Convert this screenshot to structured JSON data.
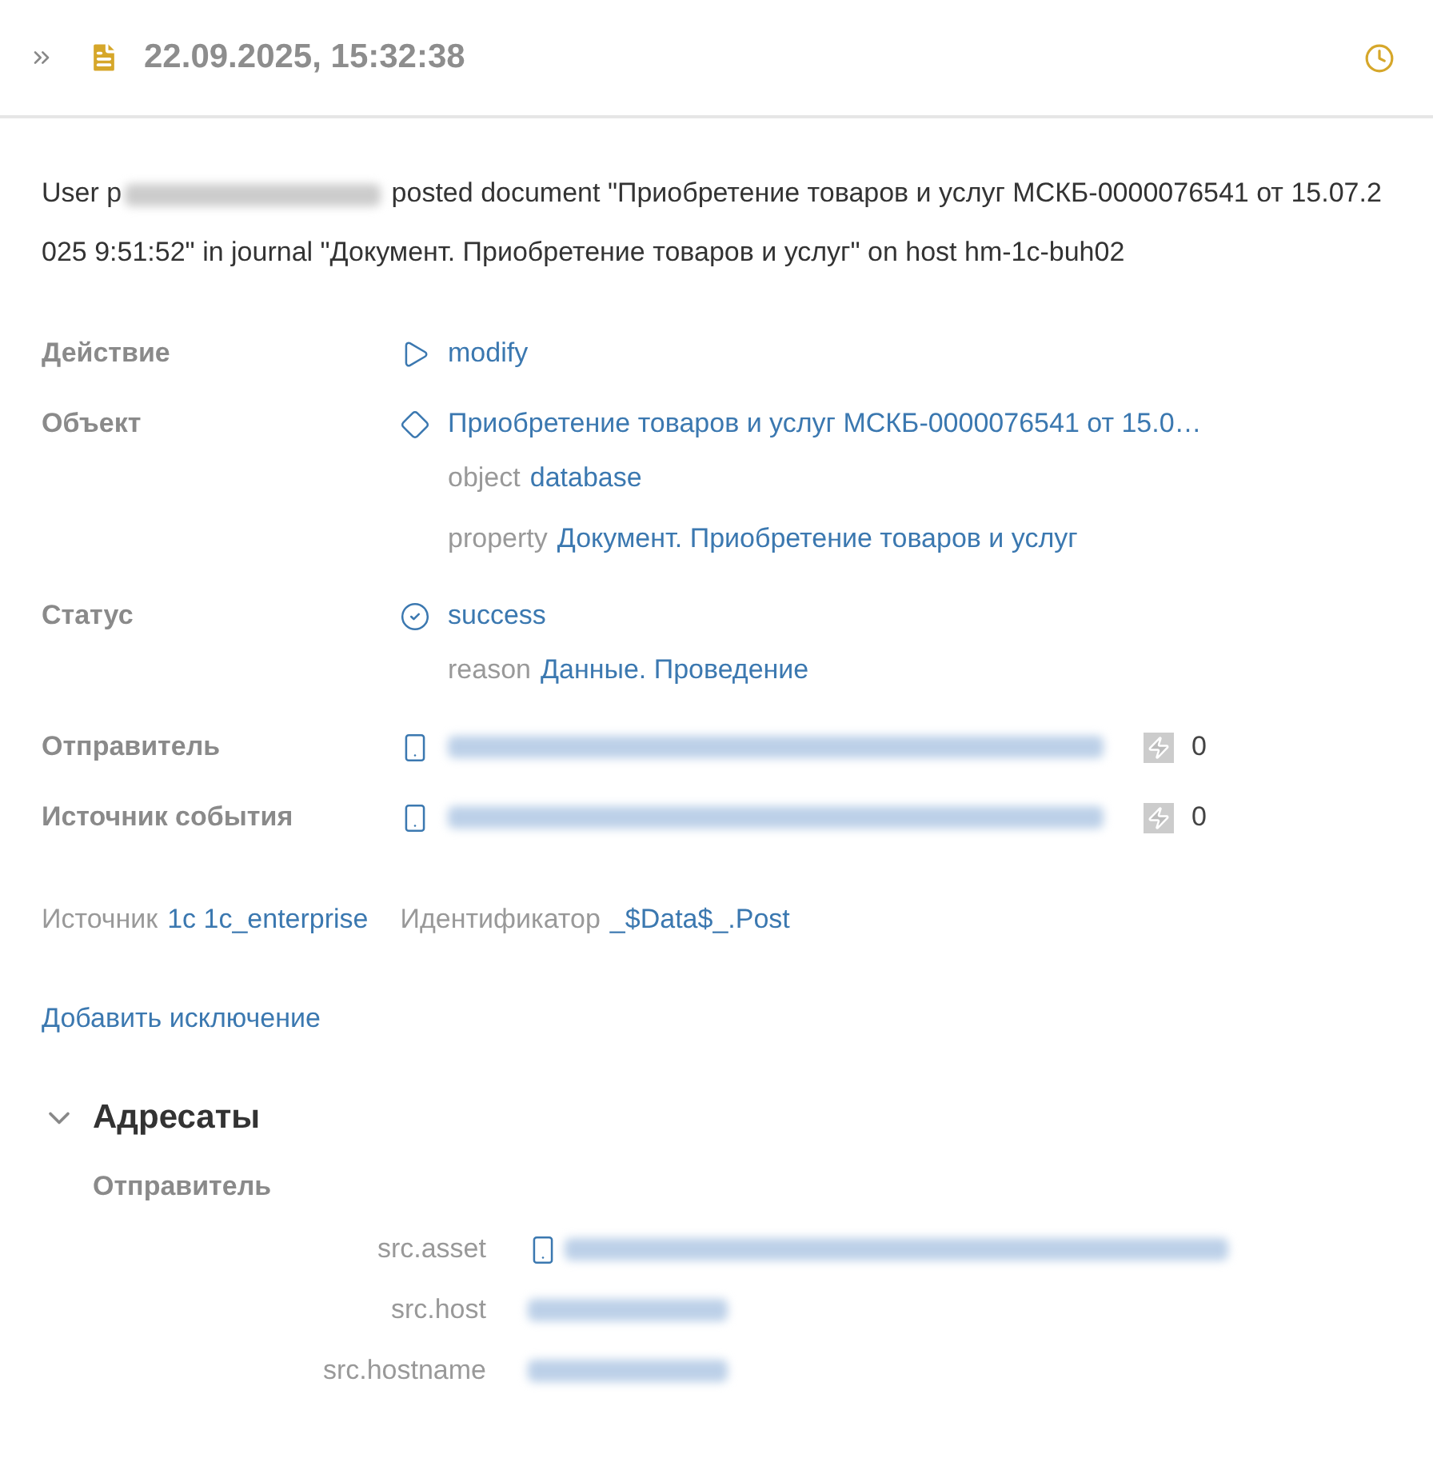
{
  "header": {
    "title": "22.09.2025, 15:32:38"
  },
  "summary": {
    "before": "User p",
    "after": " posted document \"Приобретение товаров и услуг МСКБ-0000076541 от 15.07.2025 9:51:52\" in journal \"Документ. Приобретение товаров и услуг\" on host hm-1c-buh02"
  },
  "fields": [
    {
      "label": "Действие",
      "kind": "action",
      "value": "modify"
    },
    {
      "label": "Объект",
      "kind": "object",
      "value": "Приобретение товаров и услуг МСКБ-0000076541 от 15.0…",
      "details": [
        {
          "key": "object",
          "value": "database"
        },
        {
          "key": "property",
          "value": "Документ. Приобретение товаров и услуг"
        }
      ]
    },
    {
      "label": "Статус",
      "kind": "status",
      "value": "success",
      "details": [
        {
          "key": "reason",
          "value": "Данные. Проведение"
        }
      ]
    },
    {
      "label": "Отправитель",
      "kind": "asset",
      "count": "0"
    },
    {
      "label": "Источник события",
      "kind": "asset",
      "count": "0"
    }
  ],
  "meta": [
    {
      "key": "Источник",
      "value": "1c 1c_enterprise"
    },
    {
      "key": "Идентификатор",
      "value": "_$Data$_.Post"
    }
  ],
  "add_exception_link": "Добавить исключение",
  "section": {
    "title": "Адресаты",
    "expanded": true,
    "groups": [
      {
        "title": "Отправитель",
        "rows": [
          {
            "key": "src.asset",
            "kind": "asset"
          },
          {
            "key": "src.host",
            "kind": "text"
          },
          {
            "key": "src.hostname",
            "kind": "text"
          }
        ]
      }
    ]
  }
}
